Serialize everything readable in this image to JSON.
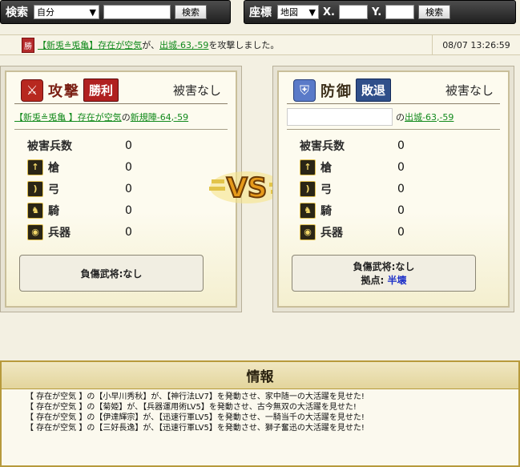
{
  "search_bar": {
    "label": "検索",
    "select_value": "自分",
    "button": "検索"
  },
  "coord_bar": {
    "label": "座標",
    "select_value": "地図",
    "x_label": "X.",
    "y_label": "Y.",
    "button": "検索"
  },
  "report": {
    "badge": "勝",
    "alliance": "【新兎≗兎亀】",
    "player": "存在が空気",
    "connector": "が、",
    "target": "出城-63,-59",
    "suffix": "を攻撃しました。",
    "time": "08/07 13:26:59"
  },
  "attack": {
    "title": "攻撃",
    "result": "勝利",
    "damage": "被害なし",
    "alliance": "【新兎≗兎亀 】",
    "player": "存在が空気",
    "no": " の",
    "location": "新規陣-64,-59",
    "losses_label": "被害兵数",
    "losses_value": "0",
    "units": [
      {
        "icon": "spear-icon",
        "label": "槍",
        "value": "0"
      },
      {
        "icon": "bow-icon",
        "label": "弓",
        "value": "0"
      },
      {
        "icon": "horse-icon",
        "label": "騎",
        "value": "0"
      },
      {
        "icon": "siege-icon",
        "label": "兵器",
        "value": "0"
      }
    ],
    "wounded": "負傷武将:なし"
  },
  "defense": {
    "title": "防御",
    "result": "敗退",
    "damage": "被害なし",
    "no": "の",
    "location": "出城-63,-59",
    "losses_label": "被害兵数",
    "losses_value": "0",
    "units": [
      {
        "icon": "spear-icon",
        "label": "槍",
        "value": "0"
      },
      {
        "icon": "bow-icon",
        "label": "弓",
        "value": "0"
      },
      {
        "icon": "horse-icon",
        "label": "騎",
        "value": "0"
      },
      {
        "icon": "siege-icon",
        "label": "兵器",
        "value": "0"
      }
    ],
    "wounded": "負傷武将:なし",
    "fort_label": "拠点: ",
    "fort_value": "半壊"
  },
  "vs": "VS",
  "info": {
    "title": "情報",
    "lines": [
      "【 存在が空気 】の【小早川秀秋】が、【神行法LV7】を発動させ、家中随一の大活躍を見せた!",
      "【 存在が空気 】の【菊姫】が、【兵器運用術LV5】を発動させ、古今無双の大活躍を見せた!",
      "【 存在が空気 】の【伊達輝宗】が、【迅速行軍LV5】を発動させ、一騎当千の大活躍を見せた!",
      "【 存在が空気 】の【三好長逸】が、【迅速行軍LV5】を発動させ、獅子奮迅の大活躍を見せた!"
    ]
  },
  "colors": {
    "accent_win": "#b02020",
    "accent_lose": "#2f4f8a",
    "link": "#128a1c",
    "fort": "#1c2fc8"
  }
}
